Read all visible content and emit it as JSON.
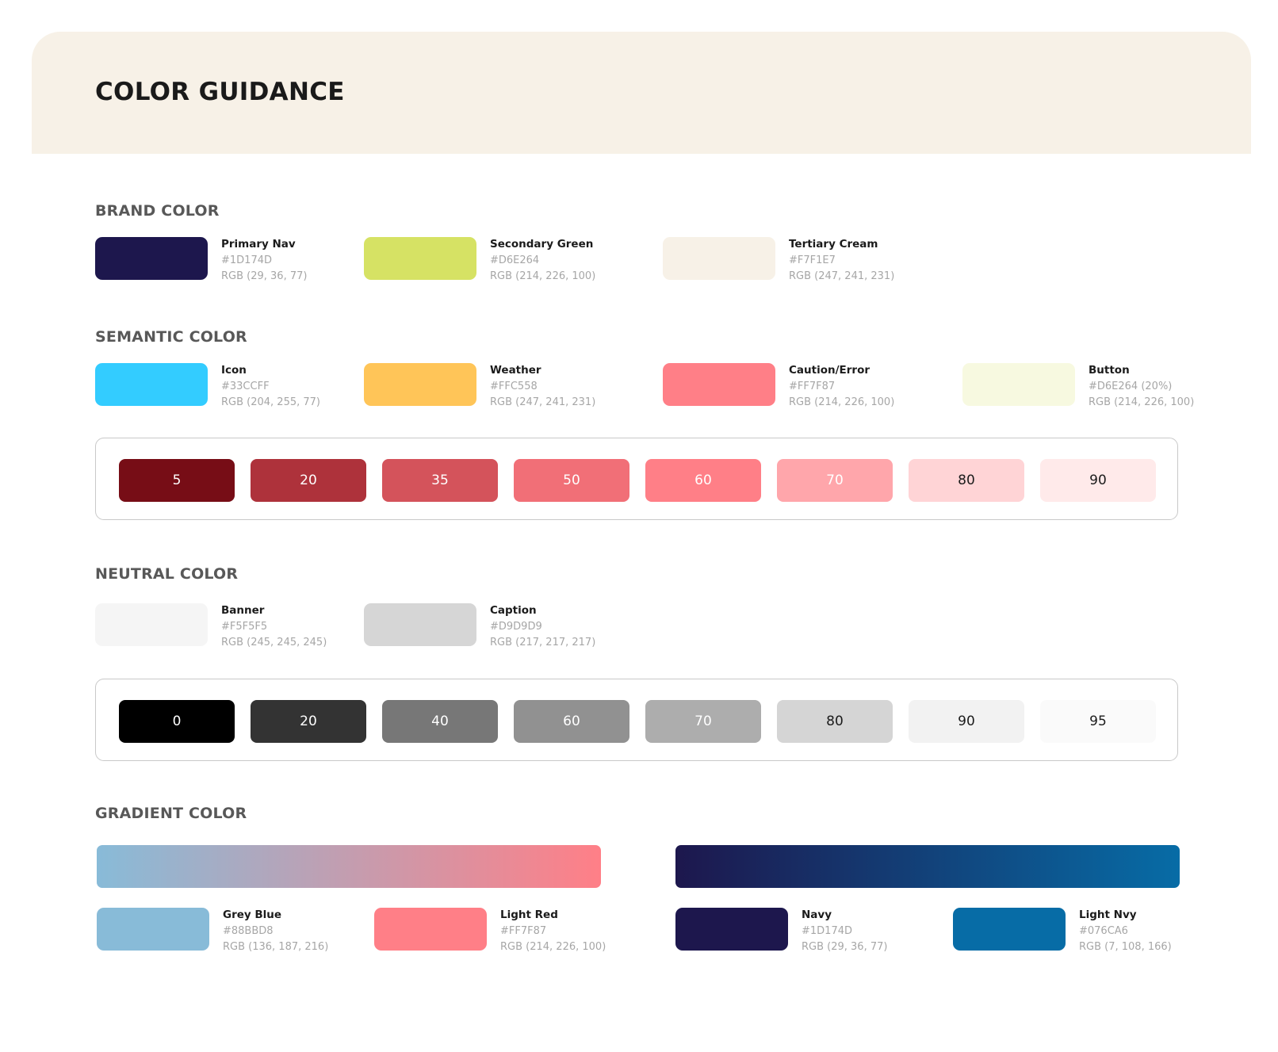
{
  "page": {
    "title": "COLOR GUIDANCE"
  },
  "brand": {
    "title": "BRAND COLOR",
    "swatches": [
      {
        "name": "Primary Nav",
        "hex": "#1D174D",
        "rgb": "RGB (29, 36, 77)",
        "color": "#1d174d"
      },
      {
        "name": "Secondary Green",
        "hex": "#D6E264",
        "rgb": "RGB (214, 226, 100)",
        "color": "#d6e264"
      },
      {
        "name": "Tertiary Cream",
        "hex": "#F7F1E7",
        "rgb": "RGB (247, 241, 231)",
        "color": "#f7f1e7"
      }
    ]
  },
  "semantic": {
    "title": "SEMANTIC COLOR",
    "swatches": [
      {
        "name": "Icon",
        "hex": "#33CCFF",
        "rgb": "RGB (204, 255, 77)",
        "color": "#33ccff"
      },
      {
        "name": "Weather",
        "hex": "#FFC558",
        "rgb": "RGB (247, 241, 231)",
        "color": "#ffc558"
      },
      {
        "name": "Caution/Error",
        "hex": "#FF7F87",
        "rgb": "RGB (214, 226, 100)",
        "color": "#ff7f87"
      },
      {
        "name": "Button",
        "hex": "#D6E264 (20%)",
        "rgb": "RGB (214, 226, 100)",
        "color": "#f7f9e0"
      }
    ],
    "scale": [
      {
        "label": "5",
        "color": "#770d16",
        "text": "#ffffff"
      },
      {
        "label": "20",
        "color": "#ae323b",
        "text": "#ffffff"
      },
      {
        "label": "35",
        "color": "#d4535b",
        "text": "#ffffff"
      },
      {
        "label": "50",
        "color": "#f16f77",
        "text": "#ffffff"
      },
      {
        "label": "60",
        "color": "#ff7f87",
        "text": "#ffffff"
      },
      {
        "label": "70",
        "color": "#ffa6ab",
        "text": "#ffffff"
      },
      {
        "label": "80",
        "color": "#ffd4d6",
        "text": "#1b1b1b"
      },
      {
        "label": "90",
        "color": "#ffeaea",
        "text": "#1b1b1b"
      }
    ]
  },
  "neutral": {
    "title": "NEUTRAL COLOR",
    "swatches": [
      {
        "name": "Banner",
        "hex": "#F5F5F5",
        "rgb": "RGB (245, 245, 245)",
        "color": "#f5f5f5"
      },
      {
        "name": "Caption",
        "hex": "#D9D9D9",
        "rgb": "RGB (217, 217, 217)",
        "color": "#d6d6d6"
      }
    ],
    "scale": [
      {
        "label": "0",
        "color": "#000000",
        "text": "#ffffff"
      },
      {
        "label": "20",
        "color": "#333333",
        "text": "#ffffff"
      },
      {
        "label": "40",
        "color": "#777777",
        "text": "#ffffff"
      },
      {
        "label": "60",
        "color": "#919191",
        "text": "#ffffff"
      },
      {
        "label": "70",
        "color": "#adadad",
        "text": "#ffffff"
      },
      {
        "label": "80",
        "color": "#d5d5d5",
        "text": "#1b1b1b"
      },
      {
        "label": "90",
        "color": "#f2f2f2",
        "text": "#1b1b1b"
      },
      {
        "label": "95",
        "color": "#fafafa",
        "text": "#1b1b1b"
      }
    ]
  },
  "gradient": {
    "title": "GRADIENT COLOR",
    "bars": [
      {
        "from": "#88bbd8",
        "to": "#ff7f87"
      },
      {
        "from": "#1d174d",
        "to": "#076ca6"
      }
    ],
    "swatches": [
      {
        "name": "Grey Blue",
        "hex": "#88BBD8",
        "rgb": "RGB (136, 187, 216)",
        "color": "#88bbd8"
      },
      {
        "name": "Light Red",
        "hex": "#FF7F87",
        "rgb": "RGB (214, 226, 100)",
        "color": "#ff7f87"
      },
      {
        "name": "Navy",
        "hex": "#1D174D",
        "rgb": "RGB (29, 36, 77)",
        "color": "#1d174d"
      },
      {
        "name": "Light Nvy",
        "hex": "#076CA6",
        "rgb": "RGB (7, 108, 166)",
        "color": "#076ca6"
      }
    ]
  }
}
